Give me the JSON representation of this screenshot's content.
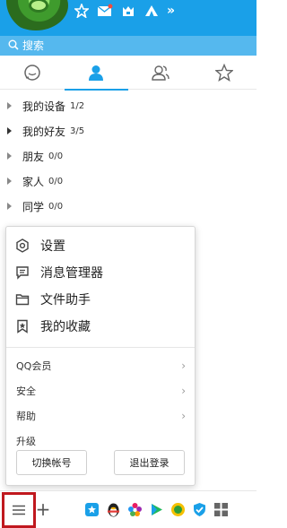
{
  "header": {
    "icons": [
      "favorites-star-icon",
      "mail-icon",
      "qzone-icon",
      "tent-icon"
    ],
    "more": "»"
  },
  "search": {
    "placeholder": "搜索"
  },
  "tabs": [
    "messages-icon",
    "contacts-icon",
    "groups-icon",
    "favorites-icon"
  ],
  "groups": [
    {
      "name": "我的设备",
      "count": "1/2"
    },
    {
      "name": "我的好友",
      "count": "3/5"
    },
    {
      "name": "朋友",
      "count": "0/0"
    },
    {
      "name": "家人",
      "count": "0/0"
    },
    {
      "name": "同学",
      "count": "0/0"
    }
  ],
  "menu": {
    "main": [
      {
        "label": "设置",
        "icon": "settings-icon"
      },
      {
        "label": "消息管理器",
        "icon": "message-manager-icon"
      },
      {
        "label": "文件助手",
        "icon": "folder-icon"
      },
      {
        "label": "我的收藏",
        "icon": "bookmark-icon"
      }
    ],
    "sub": [
      {
        "label": "QQ会员",
        "chevron": "›"
      },
      {
        "label": "安全",
        "chevron": "›"
      },
      {
        "label": "帮助",
        "chevron": "›"
      },
      {
        "label": "升级",
        "chevron": ""
      }
    ],
    "switch_label": "切换帐号",
    "logout_label": "退出登录"
  },
  "bottom": {
    "add": "+",
    "apps": [
      "wallet-icon",
      "penguin-icon",
      "flower-icon",
      "play-icon",
      "coin-icon",
      "shield-icon",
      "grid-icon"
    ]
  },
  "colors": {
    "brand": "#1aa0e8",
    "highlight": "#c0181e"
  }
}
